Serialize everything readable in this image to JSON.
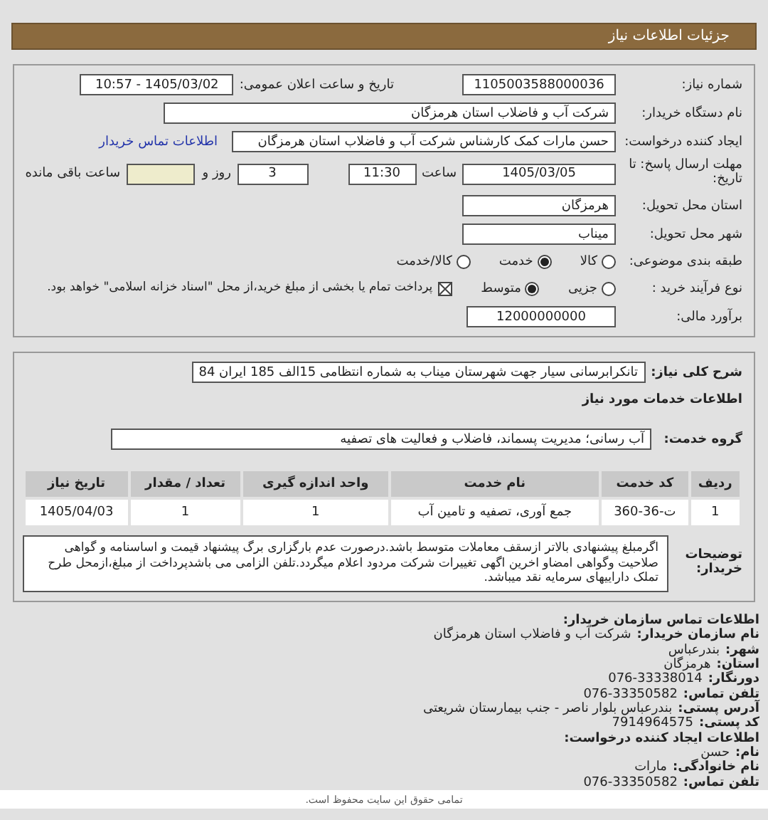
{
  "header": {
    "title": "جزئیات اطلاعات نیاز"
  },
  "form": {
    "need_number": {
      "label": "شماره نیاز:",
      "value": "1105003588000036"
    },
    "announce": {
      "label": "تاریخ و ساعت اعلان عمومی:",
      "value": "1405/03/02 - 10:57"
    },
    "buyer_org": {
      "label": "نام دستگاه خریدار:",
      "value": "شرکت آب و فاضلاب استان هرمزگان"
    },
    "requester": {
      "label": "ایجاد کننده درخواست:",
      "value": "حسن مارات کمک کارشناس شرکت آب و فاضلاب استان هرمزگان",
      "link": "اطلاعات تماس خریدار"
    },
    "deadline": {
      "label": "مهلت ارسال پاسخ: تا تاریخ:",
      "date": "1405/03/05",
      "time_label": "ساعت",
      "time": "11:30",
      "days": "3",
      "days_label": "روز و",
      "remaining_label": "ساعت باقی مانده"
    },
    "province": {
      "label": "استان محل تحویل:",
      "value": "هرمزگان"
    },
    "city": {
      "label": "شهر محل تحویل:",
      "value": "میناب"
    },
    "category": {
      "label": "طبقه بندی موضوعی:",
      "options": [
        {
          "label": "کالا",
          "selected": false
        },
        {
          "label": "خدمت",
          "selected": true
        },
        {
          "label": "کالا/خدمت",
          "selected": false
        }
      ]
    },
    "process": {
      "label": "نوع فرآیند خرید :",
      "options": [
        {
          "label": "جزیی",
          "selected": false
        },
        {
          "label": "متوسط",
          "selected": true
        }
      ],
      "payment": {
        "checked": true,
        "text": "پرداخت تمام یا بخشی از مبلغ خرید،از محل \"اسناد خزانه اسلامی\" خواهد بود."
      }
    },
    "budget": {
      "label": "برآورد مالی:",
      "value": "12000000000"
    }
  },
  "details": {
    "description": {
      "label": "شرح کلی نیاز:",
      "value": "تانکرابرسانی سیار جهت شهرستان میناب به شماره انتظامی 15الف 185 ایران 84"
    },
    "services_title": "اطلاعات خدمات مورد نیاز",
    "service_group": {
      "label": "گروه خدمت:",
      "value": "آب رسانی؛ مدیریت پسماند، فاضلاب و فعالیت های تصفیه"
    },
    "table": {
      "columns": [
        "ردیف",
        "کد خدمت",
        "نام خدمت",
        "واحد اندازه گیری",
        "تعداد / مقدار",
        "تاریخ نیاز"
      ],
      "rows": [
        [
          "1",
          "ت-36-360",
          "جمع آوری، تصفیه و تامین آب",
          "1",
          "1",
          "1405/04/03"
        ]
      ]
    },
    "notes": {
      "label": "توضیحات خریدار:",
      "value": "اگرمبلغ پیشنهادی بالاتر ازسقف معاملات متوسط باشد.درصورت عدم بارگزاری برگ پیشنهاد قیمت و اساسنامه و گواهی صلاحیت وگواهی امضاو اخرین اگهی تغییرات شرکت مردود اعلام میگردد.تلفن الزامی می باشدپرداخت از مبلغ،ازمحل طرح تملک داراییهای سرمایه نقد میباشد."
    }
  },
  "contact": {
    "title": "اطلاعات تماس سازمان خریدار:",
    "lines": [
      {
        "label": "نام سازمان خریدار:",
        "value": "شرکت آب و فاضلاب استان هرمزگان"
      },
      {
        "label": "شهر:",
        "value": "بندرعباس"
      },
      {
        "label": "استان:",
        "value": "هرمزگان"
      },
      {
        "label": "دورنگار:",
        "value": "076-33338014"
      },
      {
        "label": "تلفن تماس:",
        "value": "076-33350582"
      },
      {
        "label": "آدرس پستی:",
        "value": "بندرعباس بلوار ناصر - جنب بیمارستان شریعتی"
      },
      {
        "label": "کد پستی:",
        "value": "7914964575"
      }
    ],
    "creator_title": "اطلاعات ایجاد کننده درخواست:",
    "creator_lines": [
      {
        "label": "نام:",
        "value": "حسن"
      },
      {
        "label": "نام خانوادگی:",
        "value": "مارات"
      },
      {
        "label": "تلفن تماس:",
        "value": "076-33350582"
      }
    ]
  },
  "footer": {
    "text": "تمامی حقوق این سایت محفوظ است."
  }
}
